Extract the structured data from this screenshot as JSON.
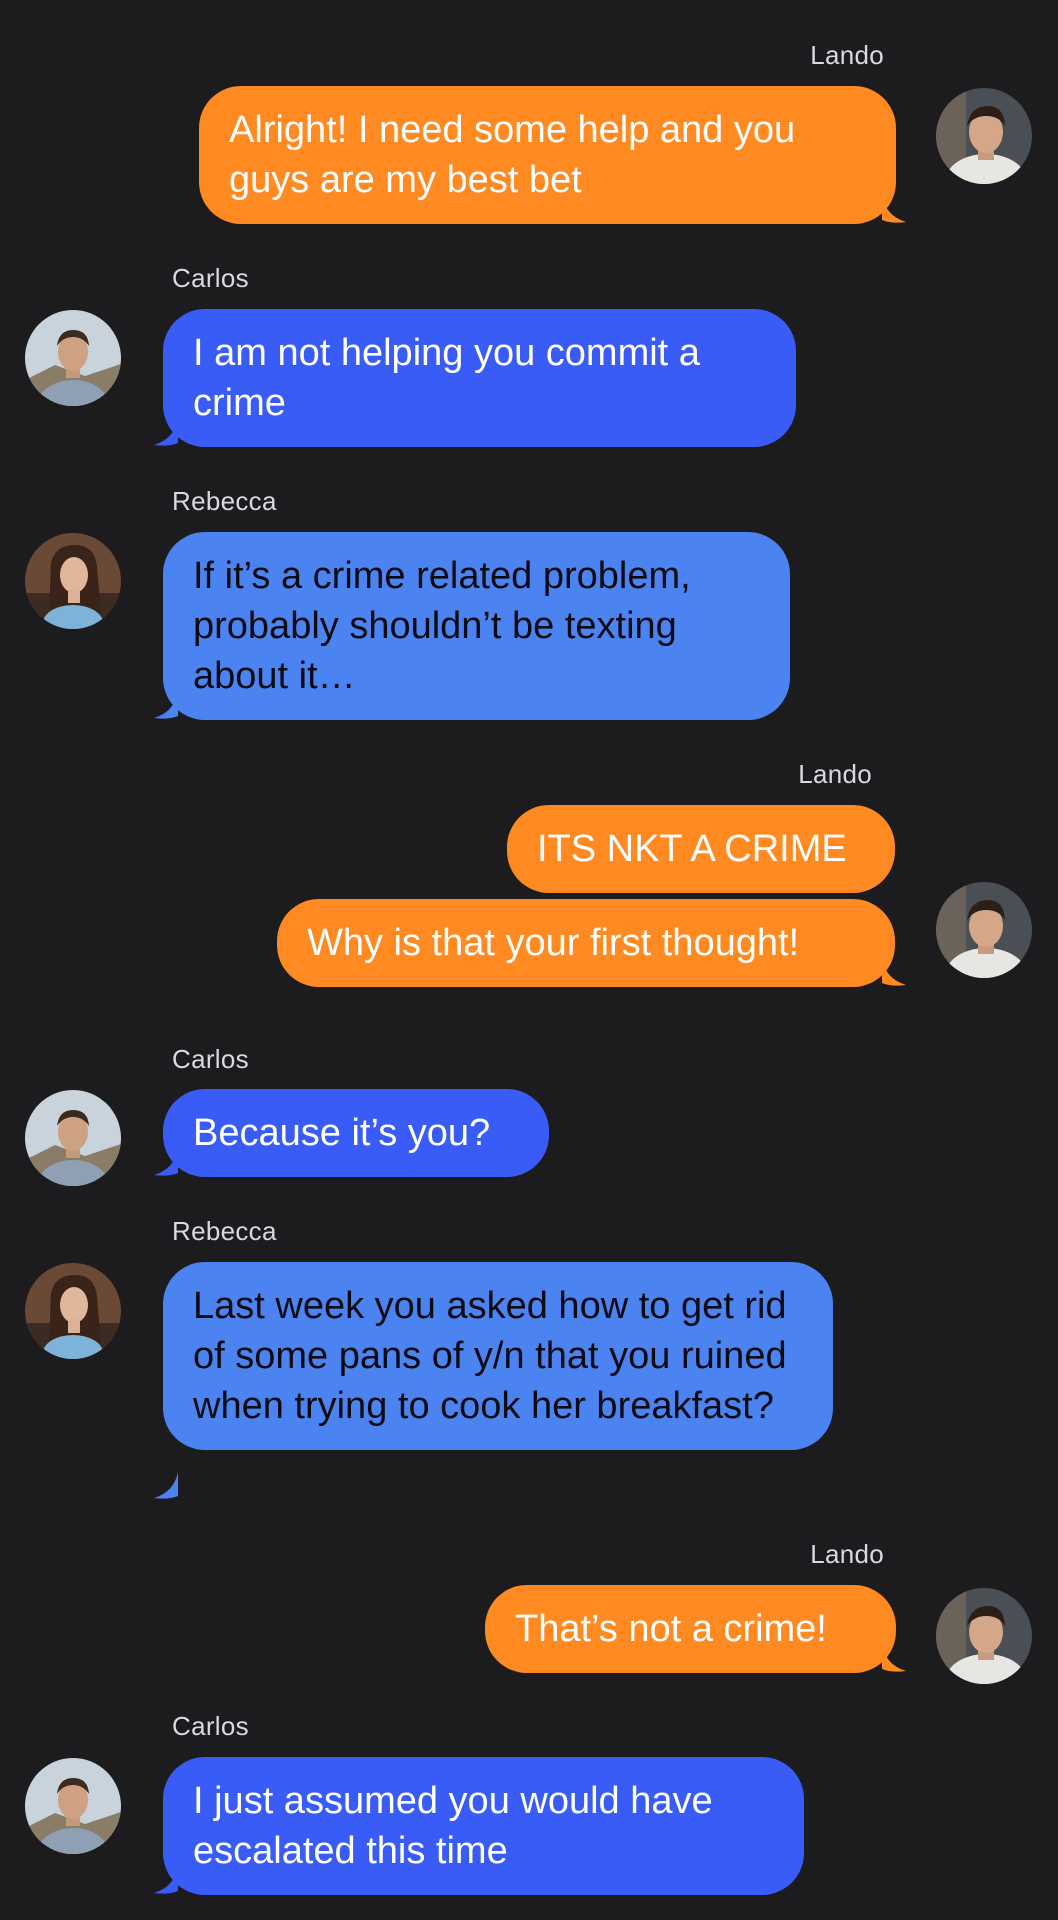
{
  "colors": {
    "background": "#1c1c1e",
    "me_bubble": "#ff8a21",
    "carlos_bubble": "#3a5cf6",
    "rebecca_bubble": "#4b84f0"
  },
  "messages": [
    {
      "sender": "Lando",
      "text": "Alright! I need some help and you guys are my best bet"
    },
    {
      "sender": "Carlos",
      "text": "I am not helping you commit a crime"
    },
    {
      "sender": "Rebecca",
      "text": "If it’s a crime related problem, probably shouldn’t be texting about it…"
    },
    {
      "sender": "Lando",
      "text": "ITS NKT A CRIME"
    },
    {
      "sender": "Lando",
      "text": "Why is that your first thought!"
    },
    {
      "sender": "Carlos",
      "text": "Because it’s you?"
    },
    {
      "sender": "Rebecca",
      "text": "Last week you asked how to get rid of some pans of y/n that you ruined when trying to cook her breakfast?"
    },
    {
      "sender": "Lando",
      "text": "That’s not a crime!"
    },
    {
      "sender": "Carlos",
      "text": "I just assumed you would have escalated this time"
    }
  ]
}
